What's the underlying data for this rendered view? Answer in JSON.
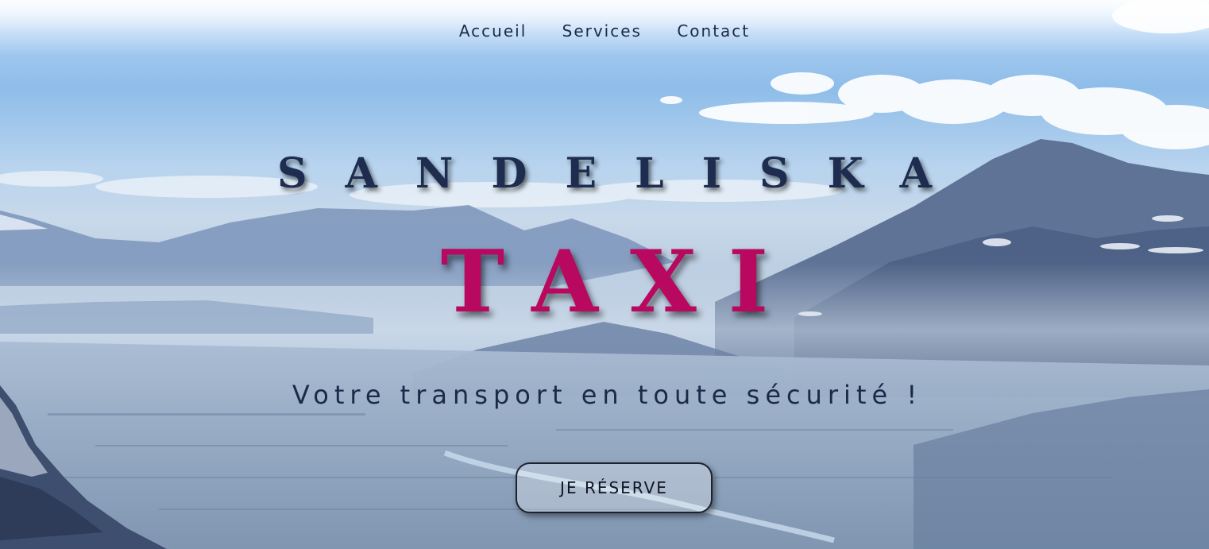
{
  "nav": {
    "items": [
      {
        "label": "Accueil"
      },
      {
        "label": "Services"
      },
      {
        "label": "Contact"
      }
    ]
  },
  "hero": {
    "brand_line1": "SANDELISKA",
    "brand_line2": "TAXI",
    "tagline": "Votre transport en toute sécurité !",
    "cta_label": "JE RÉSERVE",
    "background": "mountain-valley-photo"
  },
  "colors": {
    "brand_dark": "#1d2c4f",
    "brand_accent": "#b8085f",
    "text": "#1c2a4a"
  }
}
